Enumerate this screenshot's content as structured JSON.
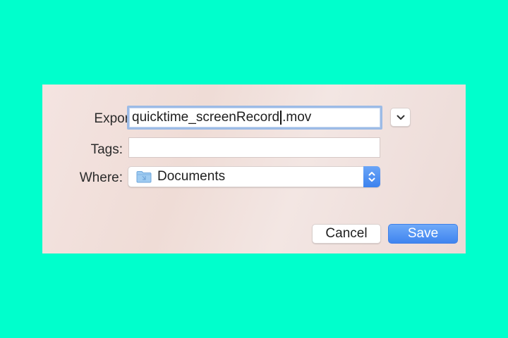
{
  "dialog": {
    "export_as_label": "Export As:",
    "filename_before_caret": "quicktime_screenRecord",
    "filename_after_caret": ".mov",
    "tags_label": "Tags:",
    "tags_value": "",
    "where_label": "Where:",
    "where_value": "Documents",
    "cancel_label": "Cancel",
    "save_label": "Save"
  },
  "icons": {
    "expand": "chevron-down-icon",
    "folder": "folder-icon",
    "stepper": "up-down-stepper-icon"
  },
  "colors": {
    "background": "#00ffcc",
    "accent": "#4a8df2",
    "focus_ring": "#9cbbe6"
  }
}
